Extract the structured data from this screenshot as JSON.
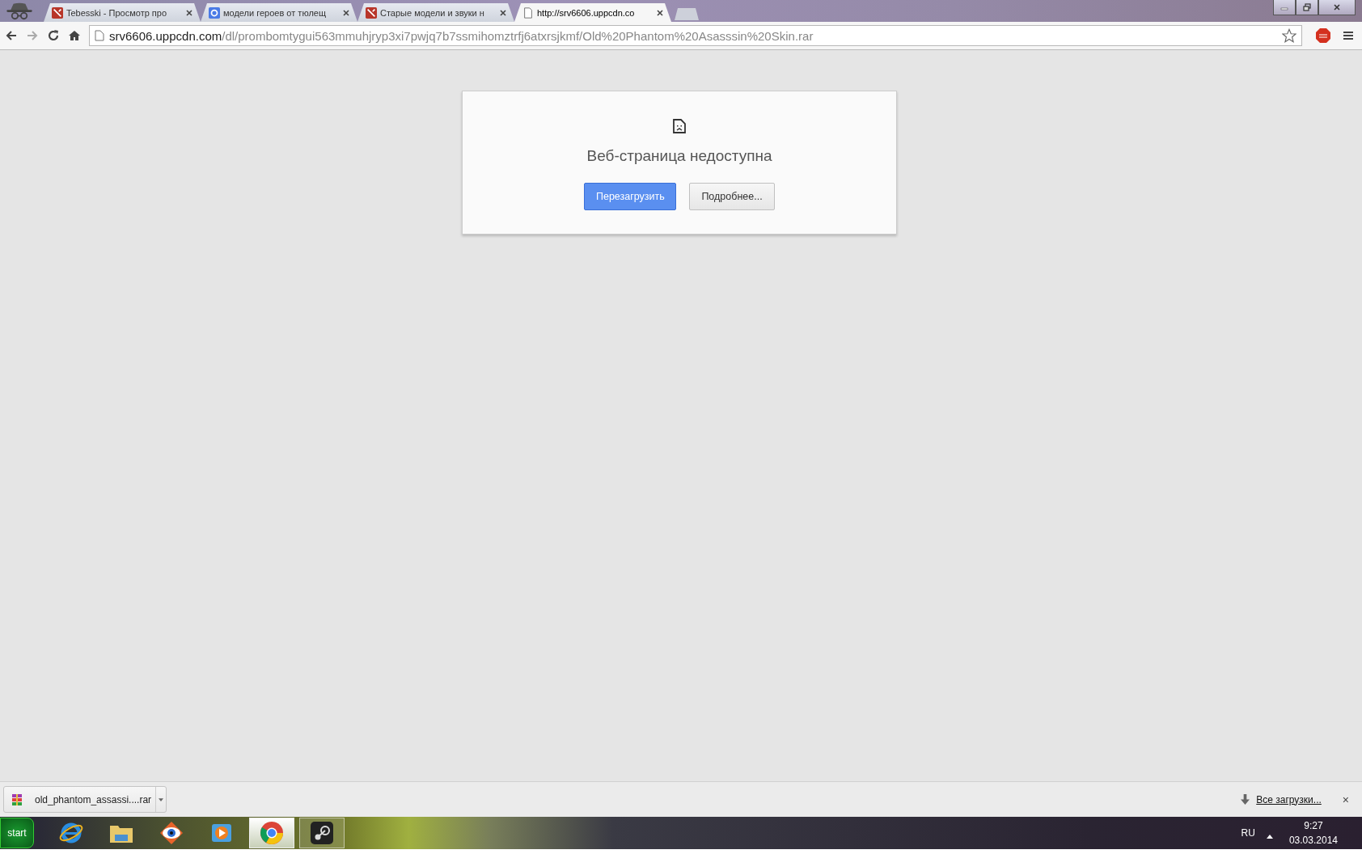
{
  "tabs": [
    {
      "title": "Tebesski - Просмотр про",
      "selected": false
    },
    {
      "title": "модели героев от тюлещ",
      "selected": false
    },
    {
      "title": "Старые модели и звуки н",
      "selected": false
    },
    {
      "title": "http://srv6606.uppcdn.co",
      "selected": true
    }
  ],
  "address_bar": {
    "host": "srv6606.uppcdn.com",
    "path": "/dl/prombomtygui563mmuhjryp3xi7pwjq7b7ssmihomztrfj6atxrsjkmf/Old%20Phantom%20Asasssin%20Skin.rar"
  },
  "error_card": {
    "heading": "Веб-страница недоступна",
    "buttons": [
      {
        "label": "Перезагрузить",
        "kind": "primary"
      },
      {
        "label": "Подробнее...",
        "kind": "secondary"
      }
    ]
  },
  "download_bar": {
    "file": "old_phantom_assassi....rar",
    "all_downloads_link": "Все загрузки...",
    "close": "×"
  },
  "taskbar": {
    "start": "start",
    "apps": [
      {
        "running": false,
        "selected": false
      },
      {
        "running": false,
        "selected": false
      },
      {
        "running": false,
        "selected": false
      },
      {
        "running": false,
        "selected": false
      },
      {
        "running": true,
        "selected": true
      },
      {
        "running": true,
        "selected": false
      }
    ],
    "language": "RU",
    "time": "9:27",
    "date": "03.03.2014"
  }
}
